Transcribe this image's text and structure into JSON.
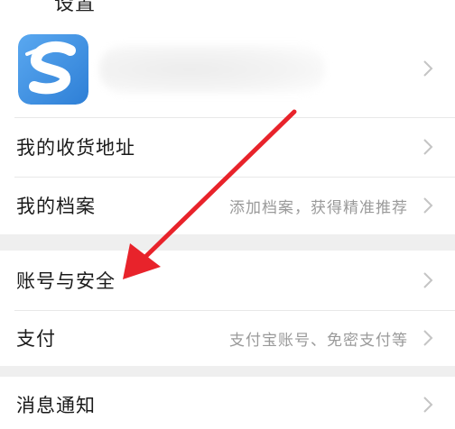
{
  "header": {
    "title": "设置"
  },
  "profile": {
    "avatar_icon": "sogou-s-logo-icon"
  },
  "group_one": {
    "address": {
      "label": "我的收货地址"
    },
    "profile_archive": {
      "label": "我的档案",
      "hint": "添加档案，获得精准推荐"
    }
  },
  "group_two": {
    "account_security": {
      "label": "账号与安全"
    },
    "payment": {
      "label": "支付",
      "hint": "支付宝账号、免密支付等"
    }
  },
  "group_three": {
    "notifications": {
      "label": "消息通知"
    }
  },
  "colors": {
    "background": "#efefef",
    "panel": "#ffffff",
    "text": "#1a1a1a",
    "hint": "#9a9a9a",
    "arrow": "#e8232b",
    "avatar_blue": "#3a8ee6"
  }
}
